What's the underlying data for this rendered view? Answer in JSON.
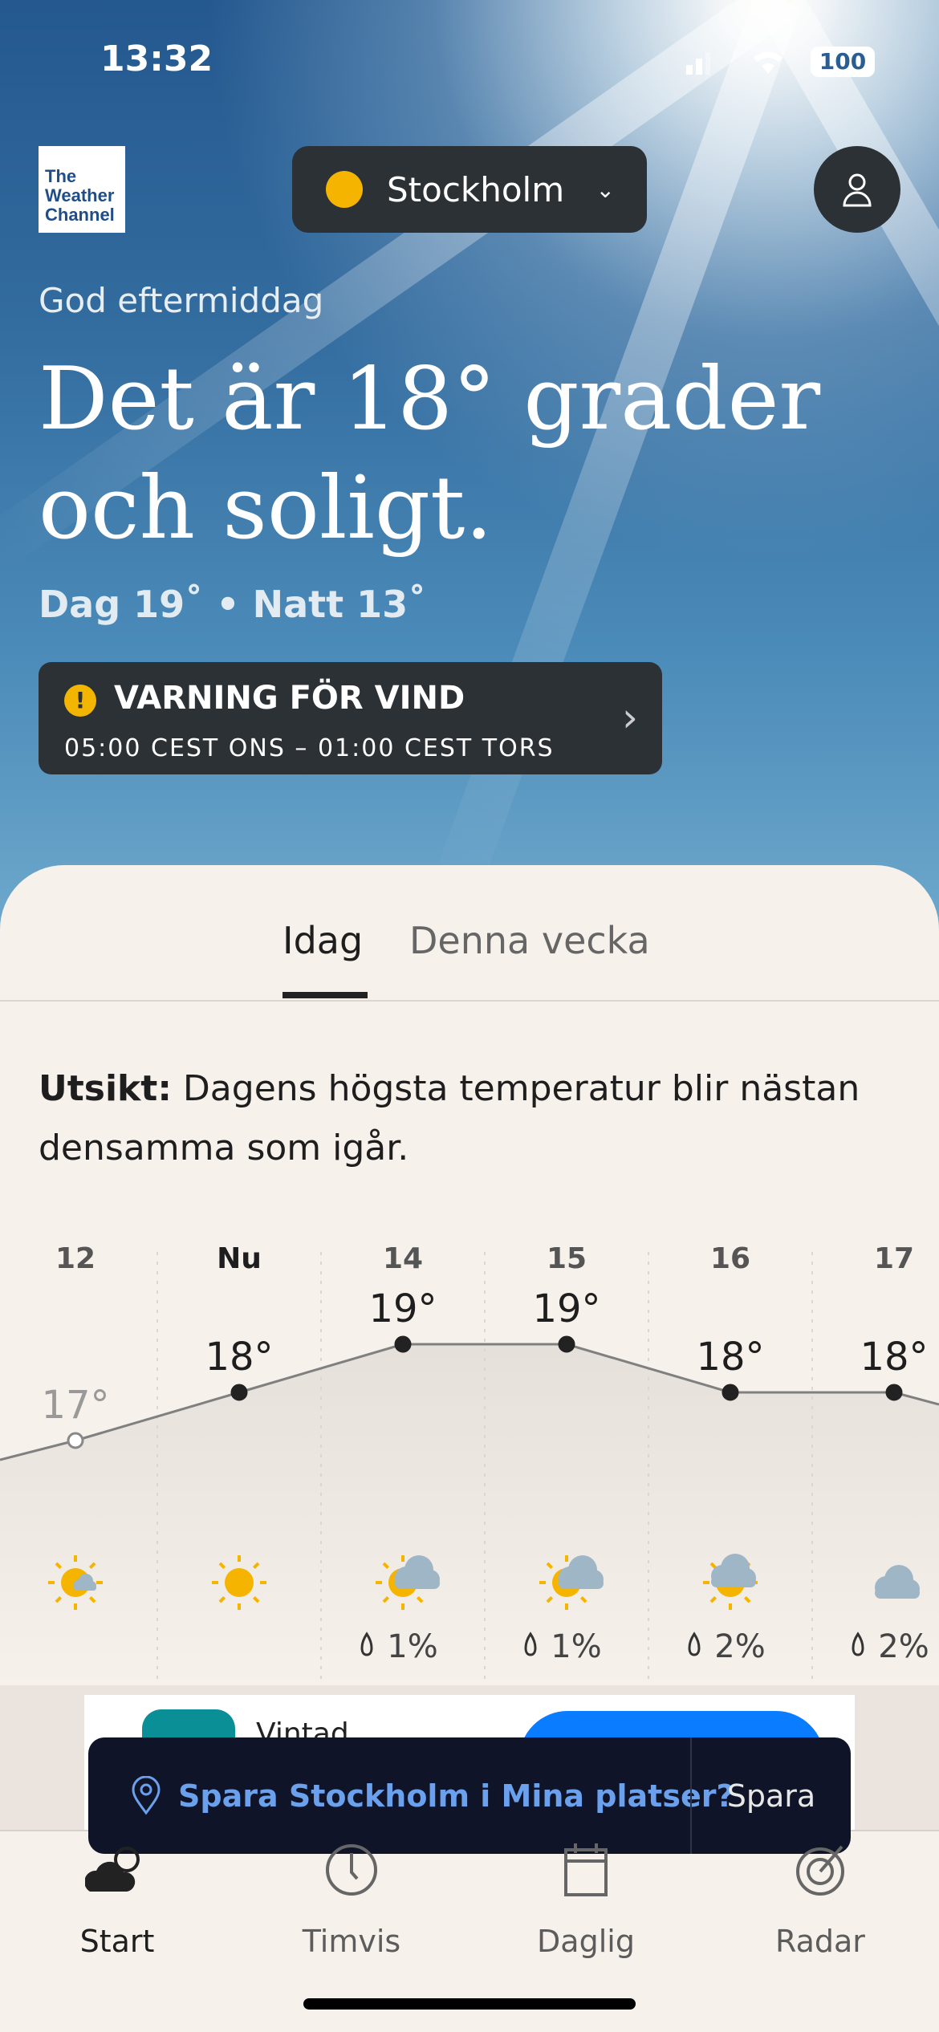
{
  "status_bar": {
    "time": "13:32",
    "battery": "100"
  },
  "header": {
    "logo": "The Weather Channel",
    "location": "Stockholm",
    "location_icon": "sun-icon",
    "profile_icon": "person-icon"
  },
  "hero": {
    "greeting": "God eftermiddag",
    "headline_line1": "Det är 18° grader",
    "headline_line2": "och soligt.",
    "day_night": "Dag 19˚ • Natt 13˚"
  },
  "warning": {
    "title": "VARNING FÖR VIND",
    "period": "05:00 CEST ONS – 01:00 CEST TORS",
    "color": "#f2b500"
  },
  "tabs": [
    {
      "label": "Idag",
      "active": true
    },
    {
      "label": "Denna vecka",
      "active": false
    }
  ],
  "outlook": {
    "label": "Utsikt:",
    "text": " Dagens högsta temperatur blir nästan densamma som igår."
  },
  "chart_data": {
    "type": "line",
    "categories": [
      "12",
      "Nu",
      "14",
      "15",
      "16",
      "17"
    ],
    "series": [
      {
        "values": [
          17,
          18,
          19,
          19,
          18,
          18
        ]
      }
    ],
    "temp_labels": [
      "17°",
      "18°",
      "19°",
      "19°",
      "18°",
      "18°"
    ],
    "conditions": [
      "sunny-partly-cloudy",
      "sunny",
      "partly-cloudy",
      "partly-cloudy",
      "cloudy-sun",
      "cloudy"
    ],
    "precip": [
      "",
      "",
      "1%",
      "1%",
      "2%",
      "2%"
    ]
  },
  "ad": {
    "advertiser": "Vintad"
  },
  "toast": {
    "message": "Spara Stockholm i Mina platser?",
    "action": "Spara"
  },
  "nav": [
    {
      "label": "Start",
      "icon": "cloud-icon",
      "active": true
    },
    {
      "label": "Timvis",
      "icon": "clock-icon"
    },
    {
      "label": "Daglig",
      "icon": "calendar-icon"
    },
    {
      "label": "Radar",
      "icon": "radar-icon"
    }
  ]
}
